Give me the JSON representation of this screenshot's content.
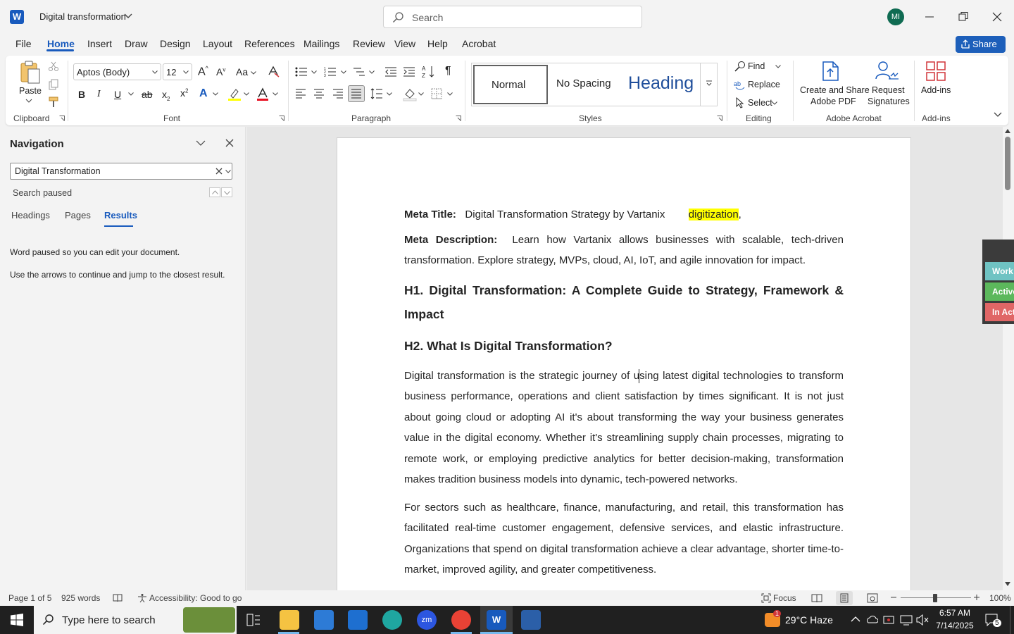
{
  "titlebar": {
    "doc_title": "Digital transformation",
    "search_placeholder": "Search",
    "avatar_initials": "MI"
  },
  "menu": [
    "File",
    "Home",
    "Insert",
    "Draw",
    "Design",
    "Layout",
    "References",
    "Mailings",
    "Review",
    "View",
    "Help",
    "Acrobat"
  ],
  "share_label": "Share",
  "ribbon": {
    "clipboard": {
      "paste_label": "Paste",
      "group": "Clipboard"
    },
    "font": {
      "name": "Aptos (Body)",
      "size": "12",
      "group": "Font",
      "change_case": "Aa"
    },
    "paragraph": {
      "group": "Paragraph"
    },
    "styles": {
      "normal": "Normal",
      "no_spacing": "No Spacing",
      "heading": "Heading",
      "group": "Styles"
    },
    "editing": {
      "find": "Find",
      "replace": "Replace",
      "select": "Select",
      "group": "Editing"
    },
    "adobe": {
      "create_share_line1": "Create and Share",
      "create_share_line2": "Adobe PDF",
      "request_line1": "Request",
      "request_line2": "Signatures",
      "group": "Adobe Acrobat"
    },
    "addins": {
      "label": "Add-ins",
      "group": "Add-ins"
    }
  },
  "navigation": {
    "title": "Navigation",
    "search_value": "Digital Transformation",
    "status": "Search paused",
    "tabs": [
      "Headings",
      "Pages",
      "Results"
    ],
    "active_tab": "Results",
    "message1": "Word paused so you can edit your document.",
    "message2": "Use the arrows to continue and jump to the closest result."
  },
  "document": {
    "meta_title_label": "Meta Title:",
    "meta_title_text": "Digital Transformation Strategy by Vartanix",
    "meta_title_highlight": "digitization",
    "meta_title_tail": ",",
    "meta_desc_label": "Meta Description:",
    "meta_desc_text": "Learn how Vartanix allows businesses with scalable, tech-driven transformation. Explore strategy, MVPs, cloud, AI, IoT, and agile innovation for impact.",
    "h1": "H1. Digital Transformation: A Complete Guide to Strategy, Framework & Impact",
    "h2": "H2. What Is Digital Transformation?",
    "para1": "Digital transformation is the strategic journey of using latest digital technologies to transform business performance, operations and client satisfaction by times significant. It is not just about going cloud or adopting AI it's about transforming the way your business generates value in the digital economy. Whether it's streamlining supply chain processes, migrating to remote work, or employing predictive analytics for better decision-making, transformation makes tradition business models into dynamic, tech-powered networks.",
    "para2": "For sectors such as healthcare, finance, manufacturing, and retail, this transformation has facilitated real-time customer engagement, defensive services, and elastic infrastructure. Organizations that spend on digital transformation achieve a clear advantage, shorter time-to-market, improved agility, and greater competitiveness."
  },
  "side_widget": [
    {
      "label": "Work",
      "color": "#6fc3c3"
    },
    {
      "label": "Active",
      "color": "#5cb85c"
    },
    {
      "label": "In Act",
      "color": "#e06666"
    }
  ],
  "statusbar": {
    "page": "Page 1 of 5",
    "words": "925 words",
    "accessibility": "Accessibility: Good to go",
    "focus": "Focus",
    "zoom": "100%"
  },
  "taskbar": {
    "search_placeholder": "Type here to search",
    "weather": "29°C  Haze",
    "time": "6:57 AM",
    "date": "7/14/2025",
    "notification_count": "5",
    "weather_badge": "1"
  }
}
